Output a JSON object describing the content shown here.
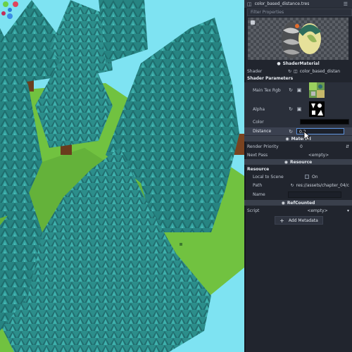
{
  "inspector": {
    "resource_tab": "color_based_distance.tres",
    "filter_placeholder": "Filter Properties",
    "material_title": "ShaderMaterial",
    "shader": {
      "label": "Shader",
      "value": "color_based_distan"
    },
    "shader_params_header": "Shader Parameters",
    "main_tex": {
      "label": "Main Tex Rgb"
    },
    "alpha": {
      "label": "Alpha"
    },
    "color": {
      "label": "Color"
    },
    "distance": {
      "label": "Distance",
      "value": "0.2"
    },
    "material_banner": "Material",
    "render_priority": {
      "label": "Render Priority",
      "value": "0"
    },
    "next_pass": {
      "label": "Next Pass",
      "value": "<empty>"
    },
    "resource_banner": "Resource",
    "resource_header": "Resource",
    "local_to_scene": {
      "label": "Local to Scene",
      "value": "On"
    },
    "path": {
      "label": "Path",
      "value": "res://assets/chapter_04/c"
    },
    "name": {
      "label": "Name",
      "value": ""
    },
    "refcounted_banner": "RefCounted",
    "script": {
      "label": "Script",
      "value": "<empty>"
    },
    "add_metadata": "Add Metadata"
  },
  "colors": {
    "sky": "#7ee3f2",
    "foliage": "#2a8a89",
    "ground": "#6fbf3e",
    "panel": "#21252e",
    "color_swatch": "#050505"
  },
  "icons": [
    "tres-file-icon",
    "menu-icon",
    "shader-file-icon",
    "revert-icon",
    "texture-icon",
    "checkbox-icon",
    "link-icon",
    "plus-icon",
    "axis-gizmo-icon"
  ]
}
